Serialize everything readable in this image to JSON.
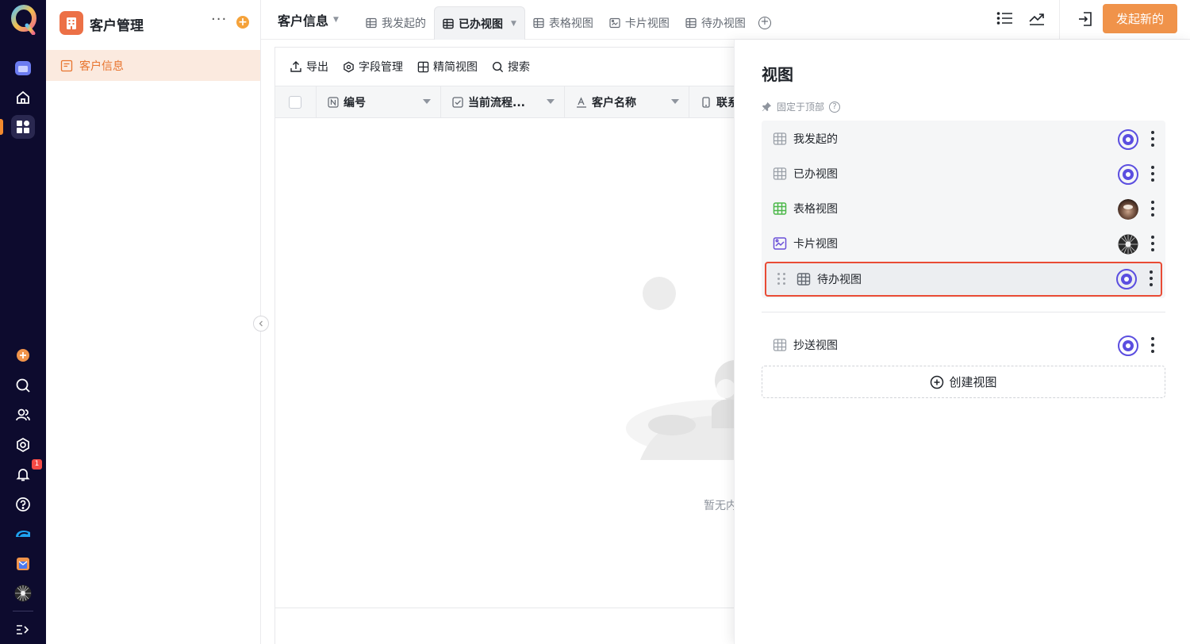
{
  "app": {
    "name": "客户管理",
    "more_label": "···",
    "add_label": "+",
    "nav": [
      {
        "label": "客户信息",
        "active": true
      }
    ]
  },
  "rail": {
    "notification_count": "1",
    "icons": [
      "app-logo",
      "calendar-app-icon",
      "home-icon",
      "workspace-grid-icon",
      "add-circle-icon",
      "search-icon",
      "contacts-icon",
      "settings-icon",
      "bell-icon",
      "help-icon",
      "brand-app-icon",
      "store-app-icon",
      "user-avatar",
      "expand-menu-icon"
    ],
    "accent_color": "#f28a2e"
  },
  "header": {
    "breadcrumb": "客户信息",
    "tabs": [
      {
        "label": "我发起的",
        "icon": "table-icon",
        "active": false
      },
      {
        "label": "已办视图",
        "icon": "table-icon",
        "active": true
      },
      {
        "label": "表格视图",
        "icon": "table-icon",
        "active": false
      },
      {
        "label": "卡片视图",
        "icon": "card-icon",
        "active": false
      },
      {
        "label": "待办视图",
        "icon": "table-icon",
        "active": false
      }
    ],
    "primary_button": "发起新的",
    "primary_color": "#f0934a"
  },
  "toolbar": {
    "export": "导出",
    "fields": "字段管理",
    "compact": "精简视图",
    "search": "搜索"
  },
  "table": {
    "columns": [
      "编号",
      "当前流程...",
      "客户名称",
      "联系"
    ],
    "empty_text": "暂无内"
  },
  "panel": {
    "title": "视图",
    "pinned_label": "固定于顶部",
    "pinned_views": [
      {
        "label": "我发起的",
        "badge": "eye"
      },
      {
        "label": "已办视图",
        "badge": "eye"
      },
      {
        "label": "表格视图",
        "badge": "avatar"
      },
      {
        "label": "卡片视图",
        "badge": "avatar"
      },
      {
        "label": "待办视图",
        "badge": "eye",
        "dragging": true
      }
    ],
    "other_views": [
      {
        "label": "抄送视图",
        "badge": "eye"
      }
    ],
    "create_label": "创建视图",
    "highlight_color": "#e94b35",
    "eye_color": "#5b4ee0"
  }
}
